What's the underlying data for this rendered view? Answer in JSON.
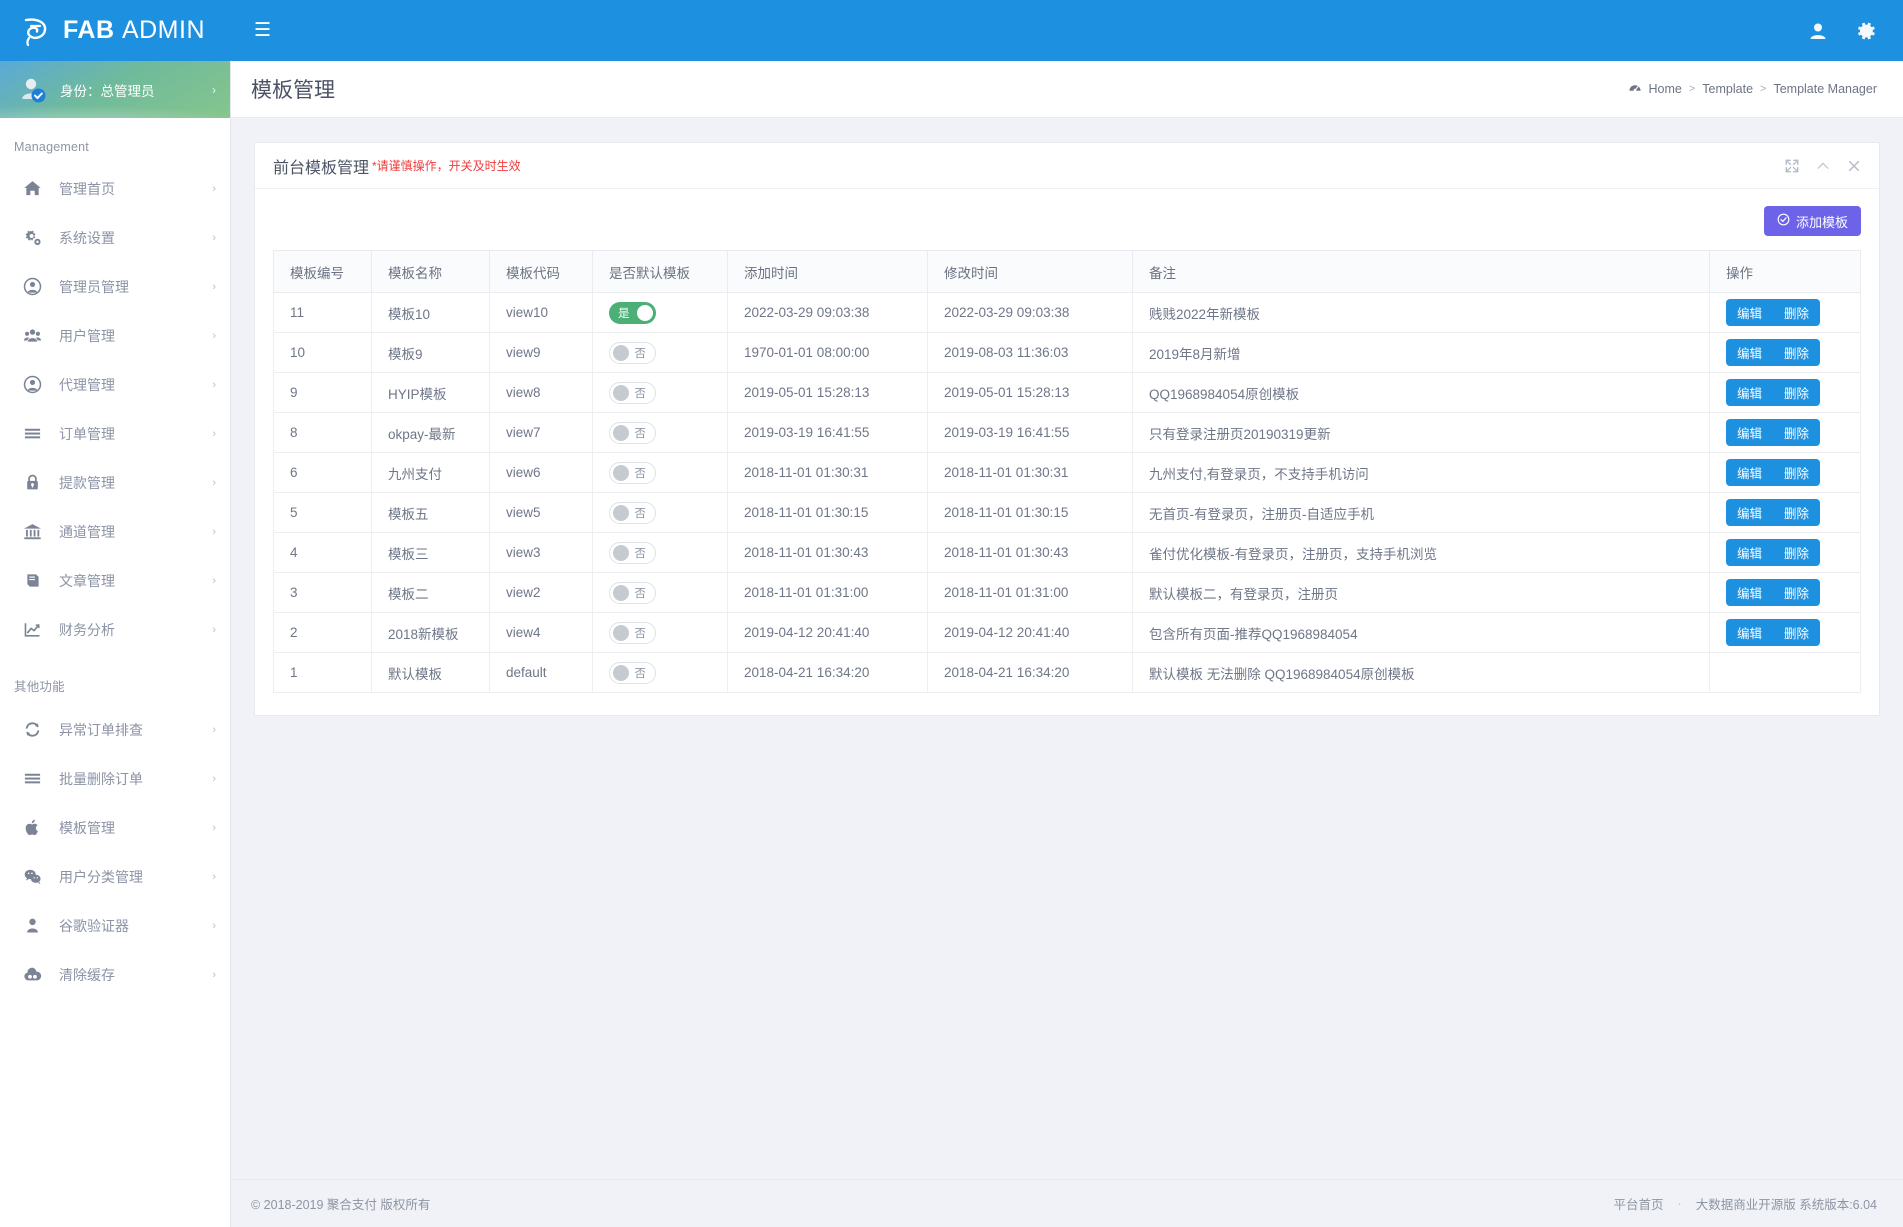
{
  "topbar": {
    "brand_bold": "FAB",
    "brand_light": "ADMIN",
    "logo_icon": "fab-logo-icon",
    "menu_toggle_icon": "hamburger-icon",
    "user_icon": "user-icon",
    "settings_icon": "gear-icon",
    "bg_color": "#1e90e0"
  },
  "sidebar": {
    "profile": {
      "label": "身份：总管理员",
      "arrow": "›",
      "avatar_icon": "avatar-verified-icon"
    },
    "section_management": "Management",
    "section_other": "其他功能",
    "management_items": [
      {
        "label": "管理首页",
        "icon": "home-icon",
        "arrow": "›"
      },
      {
        "label": "系统设置",
        "icon": "cogs-icon",
        "arrow": "›"
      },
      {
        "label": "管理员管理",
        "icon": "user-circle-icon",
        "arrow": "›"
      },
      {
        "label": "用户管理",
        "icon": "users-icon",
        "arrow": "›"
      },
      {
        "label": "代理管理",
        "icon": "user-circle-icon",
        "arrow": "›"
      },
      {
        "label": "订单管理",
        "icon": "list-icon",
        "arrow": "›"
      },
      {
        "label": "提款管理",
        "icon": "lock-icon",
        "arrow": "›"
      },
      {
        "label": "通道管理",
        "icon": "bank-icon",
        "arrow": "›"
      },
      {
        "label": "文章管理",
        "icon": "book-icon",
        "arrow": "›"
      },
      {
        "label": "财务分析",
        "icon": "chart-line-icon",
        "arrow": "›"
      }
    ],
    "other_items": [
      {
        "label": "异常订单排查",
        "icon": "refresh-icon",
        "arrow": "›"
      },
      {
        "label": "批量删除订单",
        "icon": "list-icon",
        "arrow": "›"
      },
      {
        "label": "模板管理",
        "icon": "apple-icon",
        "arrow": "›"
      },
      {
        "label": "用户分类管理",
        "icon": "wechat-icon",
        "arrow": "›"
      },
      {
        "label": "谷歌验证器",
        "icon": "person-icon",
        "arrow": "›"
      },
      {
        "label": "清除缓存",
        "icon": "cloud-icon",
        "arrow": "›"
      }
    ]
  },
  "page": {
    "title": "模板管理",
    "breadcrumb": {
      "icon": "dashboard-icon",
      "home": "Home",
      "sep": ">",
      "parent": "Template",
      "current": "Template Manager"
    }
  },
  "panel": {
    "title": "前台模板管理",
    "warning": "*请谨慎操作，开关及时生效",
    "tools": {
      "expand_icon": "expand-arrows-icon",
      "collapse_icon": "chevron-up-icon",
      "close_icon": "close-icon"
    },
    "add_button": {
      "label": "添加模板",
      "icon": "check-circle-icon",
      "color": "#6c63e8"
    }
  },
  "table": {
    "headers": [
      "模板编号",
      "模板名称",
      "模板代码",
      "是否默认模板",
      "添加时间",
      "修改时间",
      "备注",
      "操作"
    ],
    "toggle_on_label": "是",
    "toggle_off_label": "否",
    "edit_label": "编辑",
    "delete_label": "删除",
    "rows": [
      {
        "id": "11",
        "name": "模板10",
        "code": "view10",
        "is_default": true,
        "added": "2022-03-29 09:03:38",
        "modified": "2022-03-29 09:03:38",
        "remark": "贱贱2022年新模板",
        "has_actions": true
      },
      {
        "id": "10",
        "name": "模板9",
        "code": "view9",
        "is_default": false,
        "added": "1970-01-01 08:00:00",
        "modified": "2019-08-03 11:36:03",
        "remark": "2019年8月新增",
        "has_actions": true
      },
      {
        "id": "9",
        "name": "HYIP模板",
        "code": "view8",
        "is_default": false,
        "added": "2019-05-01 15:28:13",
        "modified": "2019-05-01 15:28:13",
        "remark": "QQ1968984054原创模板",
        "has_actions": true
      },
      {
        "id": "8",
        "name": "okpay-最新",
        "code": "view7",
        "is_default": false,
        "added": "2019-03-19 16:41:55",
        "modified": "2019-03-19 16:41:55",
        "remark": "只有登录注册页20190319更新",
        "has_actions": true
      },
      {
        "id": "6",
        "name": "九州支付",
        "code": "view6",
        "is_default": false,
        "added": "2018-11-01 01:30:31",
        "modified": "2018-11-01 01:30:31",
        "remark": "九州支付,有登录页，不支持手机访问",
        "has_actions": true
      },
      {
        "id": "5",
        "name": "模板五",
        "code": "view5",
        "is_default": false,
        "added": "2018-11-01 01:30:15",
        "modified": "2018-11-01 01:30:15",
        "remark": "无首页-有登录页，注册页-自适应手机",
        "has_actions": true
      },
      {
        "id": "4",
        "name": "模板三",
        "code": "view3",
        "is_default": false,
        "added": "2018-11-01 01:30:43",
        "modified": "2018-11-01 01:30:43",
        "remark": "雀付优化模板-有登录页，注册页，支持手机浏览",
        "has_actions": true
      },
      {
        "id": "3",
        "name": "模板二",
        "code": "view2",
        "is_default": false,
        "added": "2018-11-01 01:31:00",
        "modified": "2018-11-01 01:31:00",
        "remark": "默认模板二，有登录页，注册页",
        "has_actions": true
      },
      {
        "id": "2",
        "name": "2018新模板",
        "code": "view4",
        "is_default": false,
        "added": "2019-04-12 20:41:40",
        "modified": "2019-04-12 20:41:40",
        "remark": "包含所有页面-推荐QQ1968984054",
        "has_actions": true
      },
      {
        "id": "1",
        "name": "默认模板",
        "code": "default",
        "is_default": false,
        "added": "2018-04-21 16:34:20",
        "modified": "2018-04-21 16:34:20",
        "remark": "默认模板 无法删除 QQ1968984054原创模板",
        "has_actions": false
      }
    ]
  },
  "footer": {
    "copyright": "© 2018-2019 聚合支付 版权所有",
    "home_link": "平台首页",
    "dot": "·",
    "version": "大数据商业开源版 系统版本:6.04"
  }
}
